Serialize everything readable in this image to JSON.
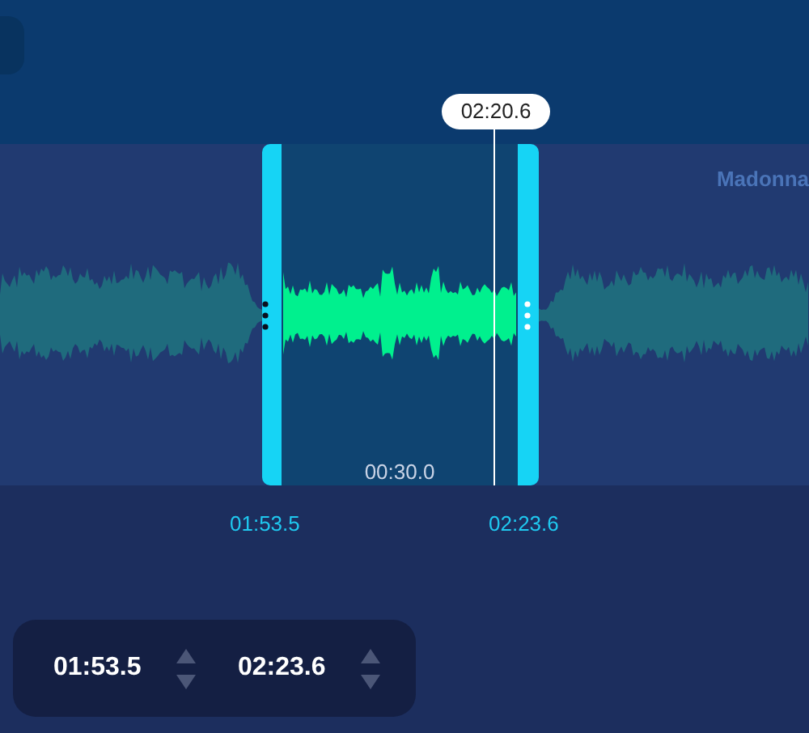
{
  "track": {
    "artist": "Madonna"
  },
  "playhead": {
    "time": "02:20.6"
  },
  "selection": {
    "duration": "00:30.0",
    "start_label": "01:53.5",
    "end_label": "02:23.6"
  },
  "time_fields": [
    {
      "value": "01:53.5"
    },
    {
      "value": "02:23.6"
    }
  ]
}
